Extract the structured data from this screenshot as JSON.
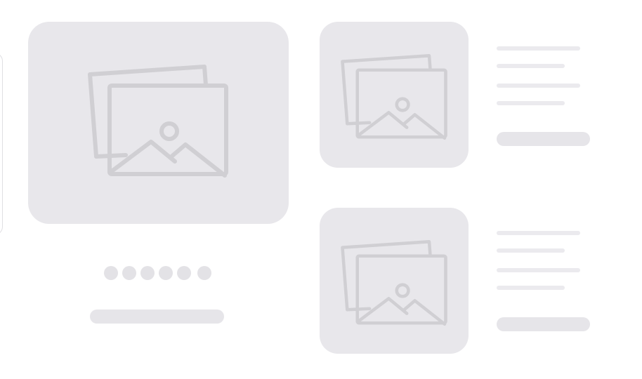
{
  "colors": {
    "card": "#e8e7eb",
    "icon_stroke": "#d0cfd3",
    "text_line": "#ebeaee",
    "button": "#e6e5e9"
  },
  "featured": {
    "icon": "image-placeholder-icon",
    "carousel_dot_count": 6
  },
  "list": [
    {
      "icon": "image-placeholder-icon",
      "text_line_count": 4
    },
    {
      "icon": "image-placeholder-icon",
      "text_line_count": 4
    }
  ]
}
